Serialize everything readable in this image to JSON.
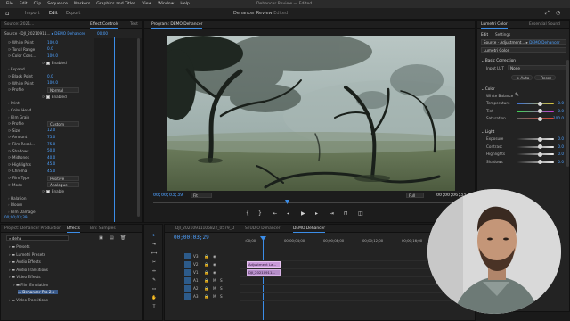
{
  "menu": {
    "items": [
      "File",
      "Edit",
      "Clip",
      "Sequence",
      "Markers",
      "Graphics and Titles",
      "View",
      "Window",
      "Help"
    ],
    "app_title": "Dehancer Review",
    "app_subtitle": "Edited"
  },
  "workspace": {
    "tabs": [
      "Import",
      "Edit",
      "Export"
    ],
    "active": "Edit"
  },
  "effect_controls": {
    "tabs": [
      "Source: 2021...",
      "Effect Controls",
      "Text"
    ],
    "source_label": "Source · DJI_20210911...",
    "sequence_label": "DEMO Dehancer",
    "timecode": "00;00",
    "rows": [
      {
        "label": "White Point",
        "value": "100.0"
      },
      {
        "label": "Tonal Range",
        "value": "0.0"
      },
      {
        "label": "Color Cons...",
        "value": "100.0"
      },
      {
        "label": "Enabled",
        "value": "",
        "checkbox": true
      },
      {
        "label": "Expand",
        "value": ""
      },
      {
        "label": "Black Point",
        "value": "0.0"
      },
      {
        "label": "White Point",
        "value": "100.0"
      },
      {
        "label": "Profile",
        "value": "Normal",
        "dropdown": true
      },
      {
        "label": "Enabled",
        "value": "",
        "checkbox": true
      },
      {
        "label": "Print",
        "value": ""
      },
      {
        "label": "Color Head",
        "value": ""
      },
      {
        "label": "Film Grain",
        "value": ""
      },
      {
        "label": "Profile",
        "value": "Custom",
        "dropdown": true
      },
      {
        "label": "Size",
        "value": "12.0"
      },
      {
        "label": "Amount",
        "value": "75.0"
      },
      {
        "label": "Film Resol...",
        "value": "75.0"
      },
      {
        "label": "Shadows",
        "value": "50.0"
      },
      {
        "label": "Midtones",
        "value": "40.0"
      },
      {
        "label": "Highlights",
        "value": "45.0"
      },
      {
        "label": "Chroma",
        "value": "45.0"
      },
      {
        "label": "Film Type",
        "value": "Positive",
        "dropdown": true
      },
      {
        "label": "Mode",
        "value": "Analogue",
        "dropdown": true
      },
      {
        "label": "Enable",
        "value": "",
        "checkbox": true
      },
      {
        "label": "Halation",
        "value": ""
      },
      {
        "label": "Bloom",
        "value": ""
      },
      {
        "label": "Film Damage",
        "value": ""
      }
    ],
    "bottom_timecode": "00;00;03;39"
  },
  "program": {
    "title": "Program: DEMO Dehancer",
    "timecode_left": "00;00;03;39",
    "fit_label": "Fit",
    "quality_label": "Full",
    "timecode_right": "00;00;06;33"
  },
  "lumetri": {
    "tabs": [
      "Lumetri Color",
      "Essential Sound"
    ],
    "subtabs": [
      "Edit",
      "Settings"
    ],
    "source_label": "Source · Adjustment...",
    "seq_label": "DEMO Dehancer",
    "effect_label": "Lumetri Color",
    "section_basic": "Basic Correction",
    "input_lut_label": "Input LUT",
    "input_lut_value": "None",
    "auto_label": "Auto",
    "reset_label": "Reset",
    "section_color": "Color",
    "white_balance_label": "White Balance",
    "sliders_color": [
      {
        "label": "Temperature",
        "value": "0.0",
        "pos": 0.62,
        "colors": [
          "#3a6fd8",
          "#d8c43a"
        ]
      },
      {
        "label": "Tint",
        "value": "0.0",
        "pos": 0.62,
        "colors": [
          "#3ad84f",
          "#c83ad8"
        ]
      },
      {
        "label": "Saturation",
        "value": "100.0",
        "pos": 0.62,
        "colors": [
          "#666666",
          "#d84a3a"
        ]
      }
    ],
    "section_light": "Light",
    "sliders_light": [
      {
        "label": "Exposure",
        "value": "0.0",
        "pos": 0.62
      },
      {
        "label": "Contrast",
        "value": "0.0",
        "pos": 0.62
      },
      {
        "label": "Highlights",
        "value": "0.0",
        "pos": 0.62
      },
      {
        "label": "Shadows",
        "value": "0.0",
        "pos": 0.62
      }
    ]
  },
  "project": {
    "tabs": [
      "Project: Dehancer Production",
      "Effects",
      "Bin: Samples"
    ],
    "search_placeholder": "deha",
    "tree": [
      {
        "label": "Presets",
        "indent": 1
      },
      {
        "label": "Lumetri Presets",
        "indent": 1
      },
      {
        "label": "Audio Effects",
        "indent": 1
      },
      {
        "label": "Audio Transitions",
        "indent": 1
      },
      {
        "label": "Video Effects",
        "indent": 1
      },
      {
        "label": "Film Emulation",
        "indent": 2
      },
      {
        "label": "Dehancer Pro 2.x",
        "indent": 3,
        "selected": true
      },
      {
        "label": "Video Transitions",
        "indent": 1
      }
    ]
  },
  "timeline": {
    "tabs": [
      "DJI_20210911105822_0579_D",
      "STUDIO Dehancer",
      "DEMO Dehancer"
    ],
    "timecode": "00;00;03;29",
    "ruler": [
      ":00;00",
      "00;00;04;00",
      "00;00;08;00",
      "00;00;12;00",
      "00;00;16;00",
      "00;00;20;00"
    ],
    "video_tracks": [
      "V3",
      "V2",
      "V1"
    ],
    "audio_tracks": [
      "A1",
      "A2",
      "A3"
    ],
    "clip_top": "Adjustment La...",
    "clip_bottom": "DJI_20210911..."
  },
  "colors": {
    "accent": "#3b8de8",
    "timecode": "#4ea1ff",
    "clip": "#c99ad9",
    "clip2": "#d8a8e6"
  }
}
